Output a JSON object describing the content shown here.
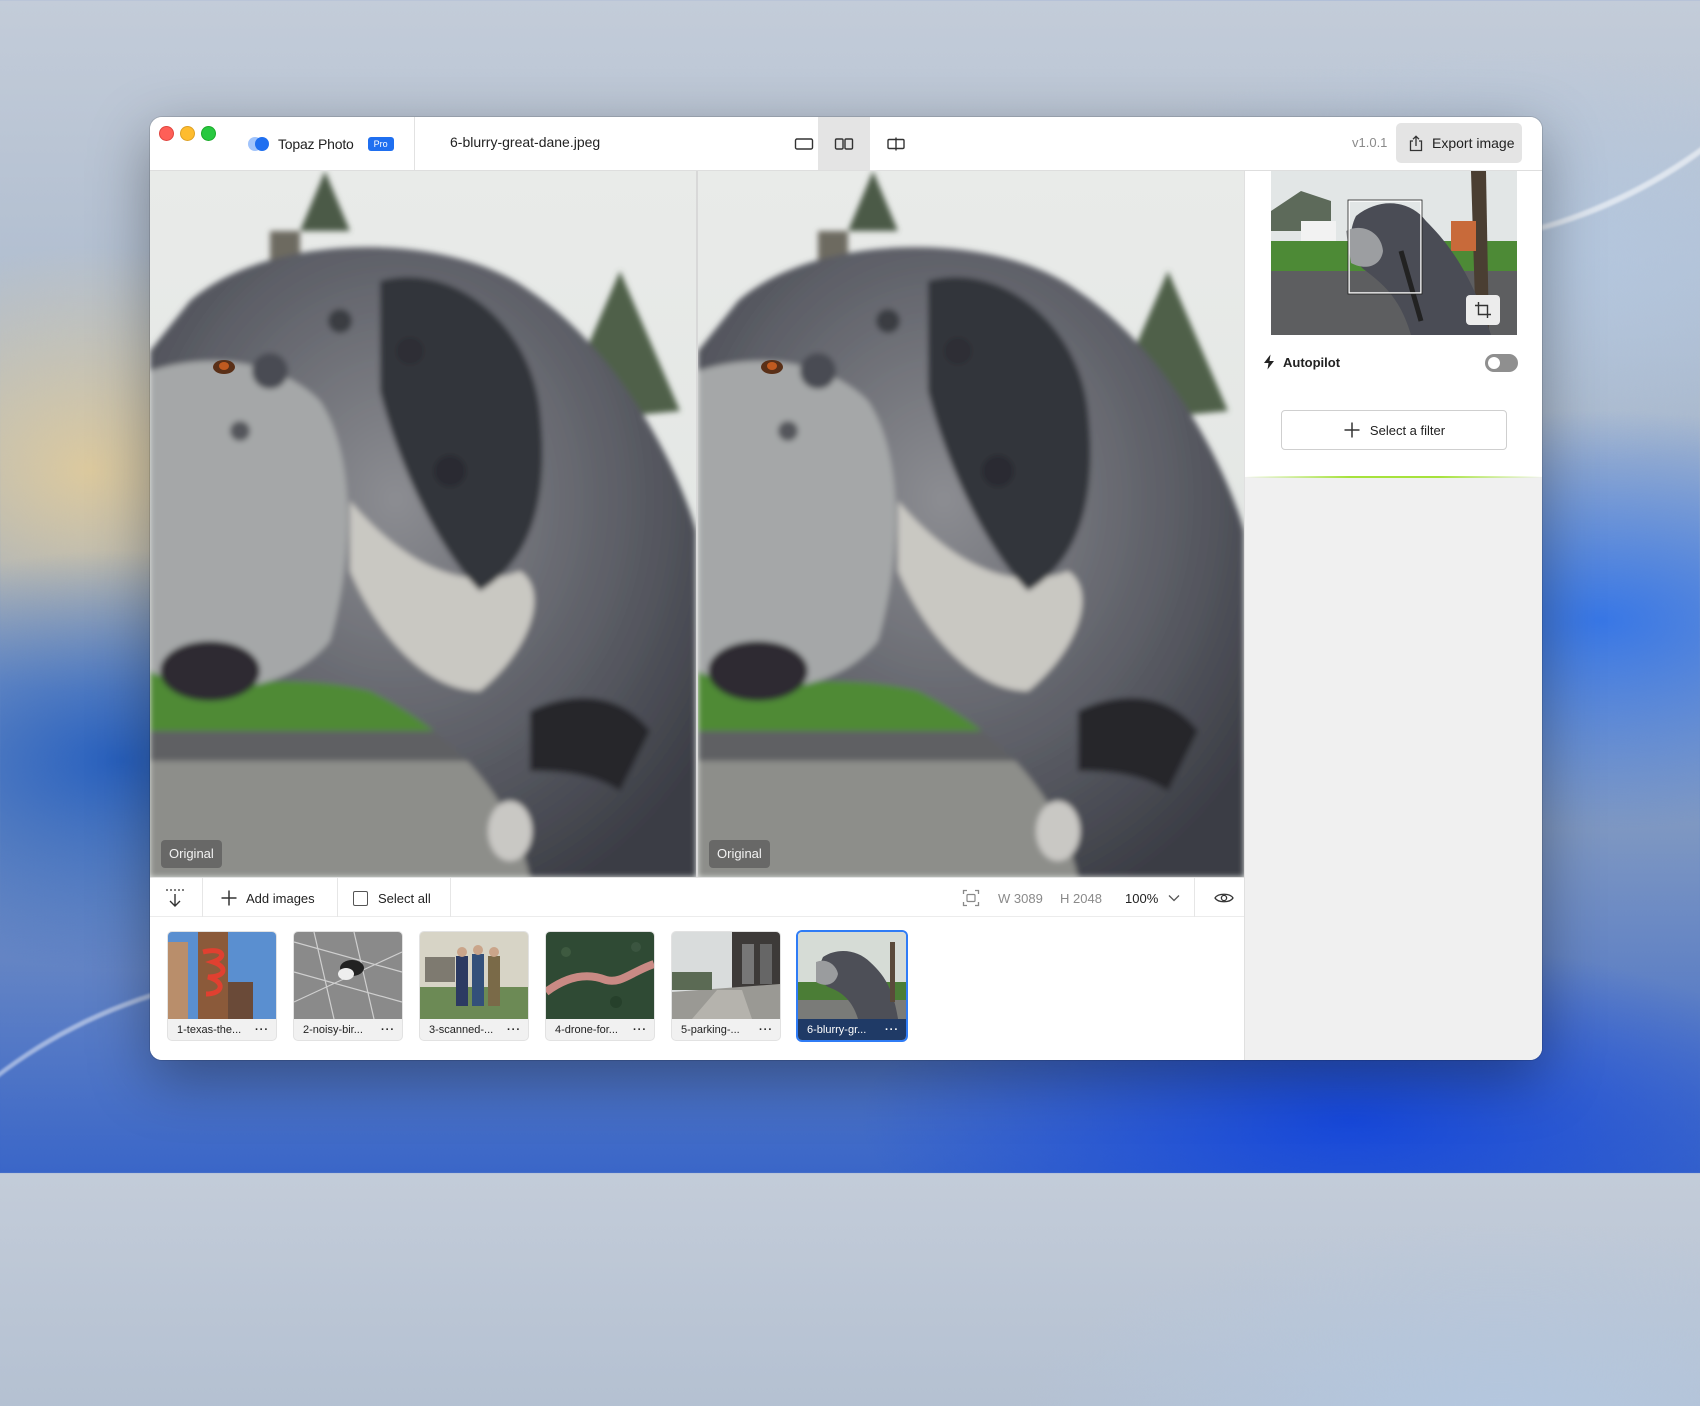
{
  "app": {
    "name": "Topaz Photo",
    "badge": "Pro",
    "filename": "6-blurry-great-dane.jpeg",
    "version": "v1.0.1",
    "export_label": "Export image"
  },
  "view_modes": [
    {
      "icon": "single-view-icon",
      "active": false
    },
    {
      "icon": "side-by-side-view-icon",
      "active": true
    },
    {
      "icon": "split-view-icon",
      "active": false
    }
  ],
  "canvas": {
    "left_label": "Original",
    "right_label": "Original"
  },
  "toolbar": {
    "add_images_label": "Add images",
    "select_all_label": "Select all",
    "width_text": "W 3089",
    "height_text": "H 2048",
    "zoom": "100%"
  },
  "filmstrip": [
    {
      "name": "1-texas-the...",
      "selected": false
    },
    {
      "name": "2-noisy-bir...",
      "selected": false
    },
    {
      "name": "3-scanned-...",
      "selected": false
    },
    {
      "name": "4-drone-for...",
      "selected": false
    },
    {
      "name": "5-parking-...",
      "selected": false
    },
    {
      "name": "6-blurry-gr...",
      "selected": true
    }
  ],
  "sidebar": {
    "autopilot_label": "Autopilot",
    "autopilot_on": false,
    "select_filter_label": "Select a filter"
  },
  "colors": {
    "accent": "#1f6ff0",
    "selected_border": "#2f7cf6",
    "progress_green": "#a6e23c"
  }
}
